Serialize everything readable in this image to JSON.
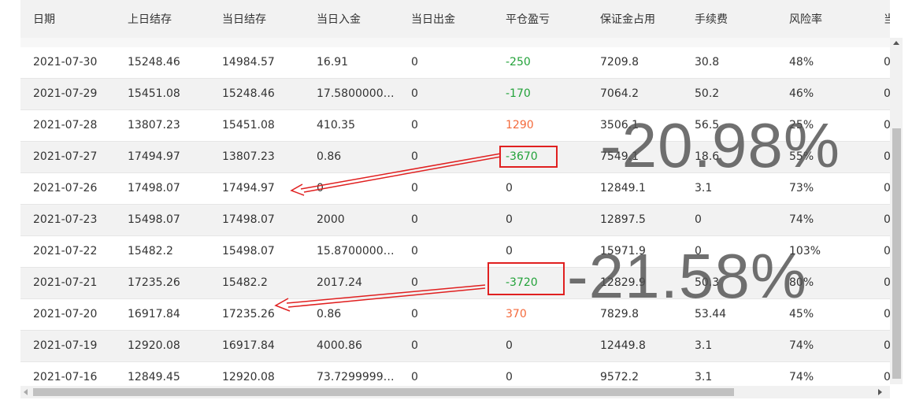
{
  "columns": [
    "日期",
    "上日结存",
    "当日结存",
    "当日入金",
    "当日出金",
    "平仓盈亏",
    "保证金占用",
    "手续费",
    "风险率",
    "当日"
  ],
  "rows": [
    {
      "date": "2021-07-30",
      "prev": "15248.46",
      "curr": "14984.57",
      "dep": "16.91",
      "wd": "0",
      "pnl": "-250",
      "pnl_color": "green",
      "margin": "7209.8",
      "fee": "30.8",
      "risk": "48%",
      "extra": "0"
    },
    {
      "date": "2021-07-29",
      "prev": "15451.08",
      "curr": "15248.46",
      "dep": "17.5800000…",
      "wd": "0",
      "pnl": "-170",
      "pnl_color": "green",
      "margin": "7064.2",
      "fee": "50.2",
      "risk": "46%",
      "extra": "0"
    },
    {
      "date": "2021-07-28",
      "prev": "13807.23",
      "curr": "15451.08",
      "dep": "410.35",
      "wd": "0",
      "pnl": "1290",
      "pnl_color": "red",
      "margin": "3506.1",
      "fee": "56.5",
      "risk": "25%",
      "extra": "0"
    },
    {
      "date": "2021-07-27",
      "prev": "17494.97",
      "curr": "13807.23",
      "dep": "0.86",
      "wd": "0",
      "pnl": "-3670",
      "pnl_color": "green",
      "margin": "7549.1",
      "fee": "18.6",
      "risk": "55%",
      "extra": "0"
    },
    {
      "date": "2021-07-26",
      "prev": "17498.07",
      "curr": "17494.97",
      "dep": "0",
      "wd": "0",
      "pnl": "0",
      "pnl_color": "none",
      "margin": "12849.1",
      "fee": "3.1",
      "risk": "73%",
      "extra": "0"
    },
    {
      "date": "2021-07-23",
      "prev": "15498.07",
      "curr": "17498.07",
      "dep": "2000",
      "wd": "0",
      "pnl": "0",
      "pnl_color": "none",
      "margin": "12897.5",
      "fee": "0",
      "risk": "74%",
      "extra": "0"
    },
    {
      "date": "2021-07-22",
      "prev": "15482.2",
      "curr": "15498.07",
      "dep": "15.8700000…",
      "wd": "0",
      "pnl": "0",
      "pnl_color": "none",
      "margin": "15971.9",
      "fee": "0",
      "risk": "103%",
      "extra": "0"
    },
    {
      "date": "2021-07-21",
      "prev": "17235.26",
      "curr": "15482.2",
      "dep": "2017.24",
      "wd": "0",
      "pnl": "-3720",
      "pnl_color": "green",
      "margin": "12829.9",
      "fee": "50.3",
      "risk": "80%",
      "extra": "0"
    },
    {
      "date": "2021-07-20",
      "prev": "16917.84",
      "curr": "17235.26",
      "dep": "0.86",
      "wd": "0",
      "pnl": "370",
      "pnl_color": "red",
      "margin": "7829.8",
      "fee": "53.44",
      "risk": "45%",
      "extra": "0"
    },
    {
      "date": "2021-07-19",
      "prev": "12920.08",
      "curr": "16917.84",
      "dep": "4000.86",
      "wd": "0",
      "pnl": "0",
      "pnl_color": "none",
      "margin": "12449.8",
      "fee": "3.1",
      "risk": "74%",
      "extra": "0"
    },
    {
      "date": "2021-07-16",
      "prev": "12849.45",
      "curr": "12920.08",
      "dep": "73.7299999…",
      "wd": "0",
      "pnl": "0",
      "pnl_color": "none",
      "margin": "9572.2",
      "fee": "3.1",
      "risk": "74%",
      "extra": "0"
    }
  ],
  "annotations": {
    "label_1": "-20.98%",
    "label_2": "-21.58%",
    "accent_color": "#e02020"
  }
}
